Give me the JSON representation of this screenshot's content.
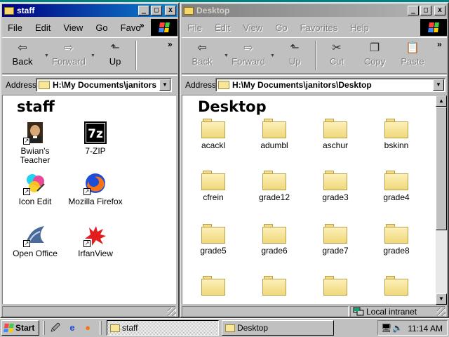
{
  "staff_window": {
    "title": "staff",
    "menu": [
      "File",
      "Edit",
      "View",
      "Go",
      "Favo"
    ],
    "toolbar": {
      "back": "Back",
      "forward": "Forward",
      "up": "Up"
    },
    "address_label": "Address",
    "address_value": "H:\\My Documents\\janitors",
    "folder_title": "staff",
    "items": [
      {
        "label": "Bwian's\nTeacher",
        "icon": "teacher-portrait-icon"
      },
      {
        "label": "7-ZIP",
        "icon": "seven-zip-icon"
      },
      {
        "label": "Icon Edit",
        "icon": "icon-edit-icon"
      },
      {
        "label": "Mozilla Firefox",
        "icon": "firefox-icon"
      },
      {
        "label": "Open Office",
        "icon": "openoffice-icon"
      },
      {
        "label": "IrfanView",
        "icon": "irfanview-icon"
      }
    ]
  },
  "desktop_window": {
    "title": "Desktop",
    "menu": [
      "File",
      "Edit",
      "View",
      "Go",
      "Favorites",
      "Help"
    ],
    "toolbar": {
      "back": "Back",
      "forward": "Forward",
      "up": "Up",
      "cut": "Cut",
      "copy": "Copy",
      "paste": "Paste"
    },
    "address_label": "Address",
    "address_value": "H:\\My Documents\\janitors\\Desktop",
    "folder_title": "Desktop",
    "folders": [
      "acackl",
      "adumbl",
      "aschur",
      "bskinn",
      "cfrein",
      "grade12",
      "grade3",
      "grade4",
      "grade5",
      "grade6",
      "grade7",
      "grade8",
      "",
      "",
      "",
      ""
    ],
    "status_zone": "Local intranet"
  },
  "taskbar": {
    "start_label": "Start",
    "tasks": [
      "staff",
      "Desktop"
    ],
    "clock": "11:14 AM"
  }
}
